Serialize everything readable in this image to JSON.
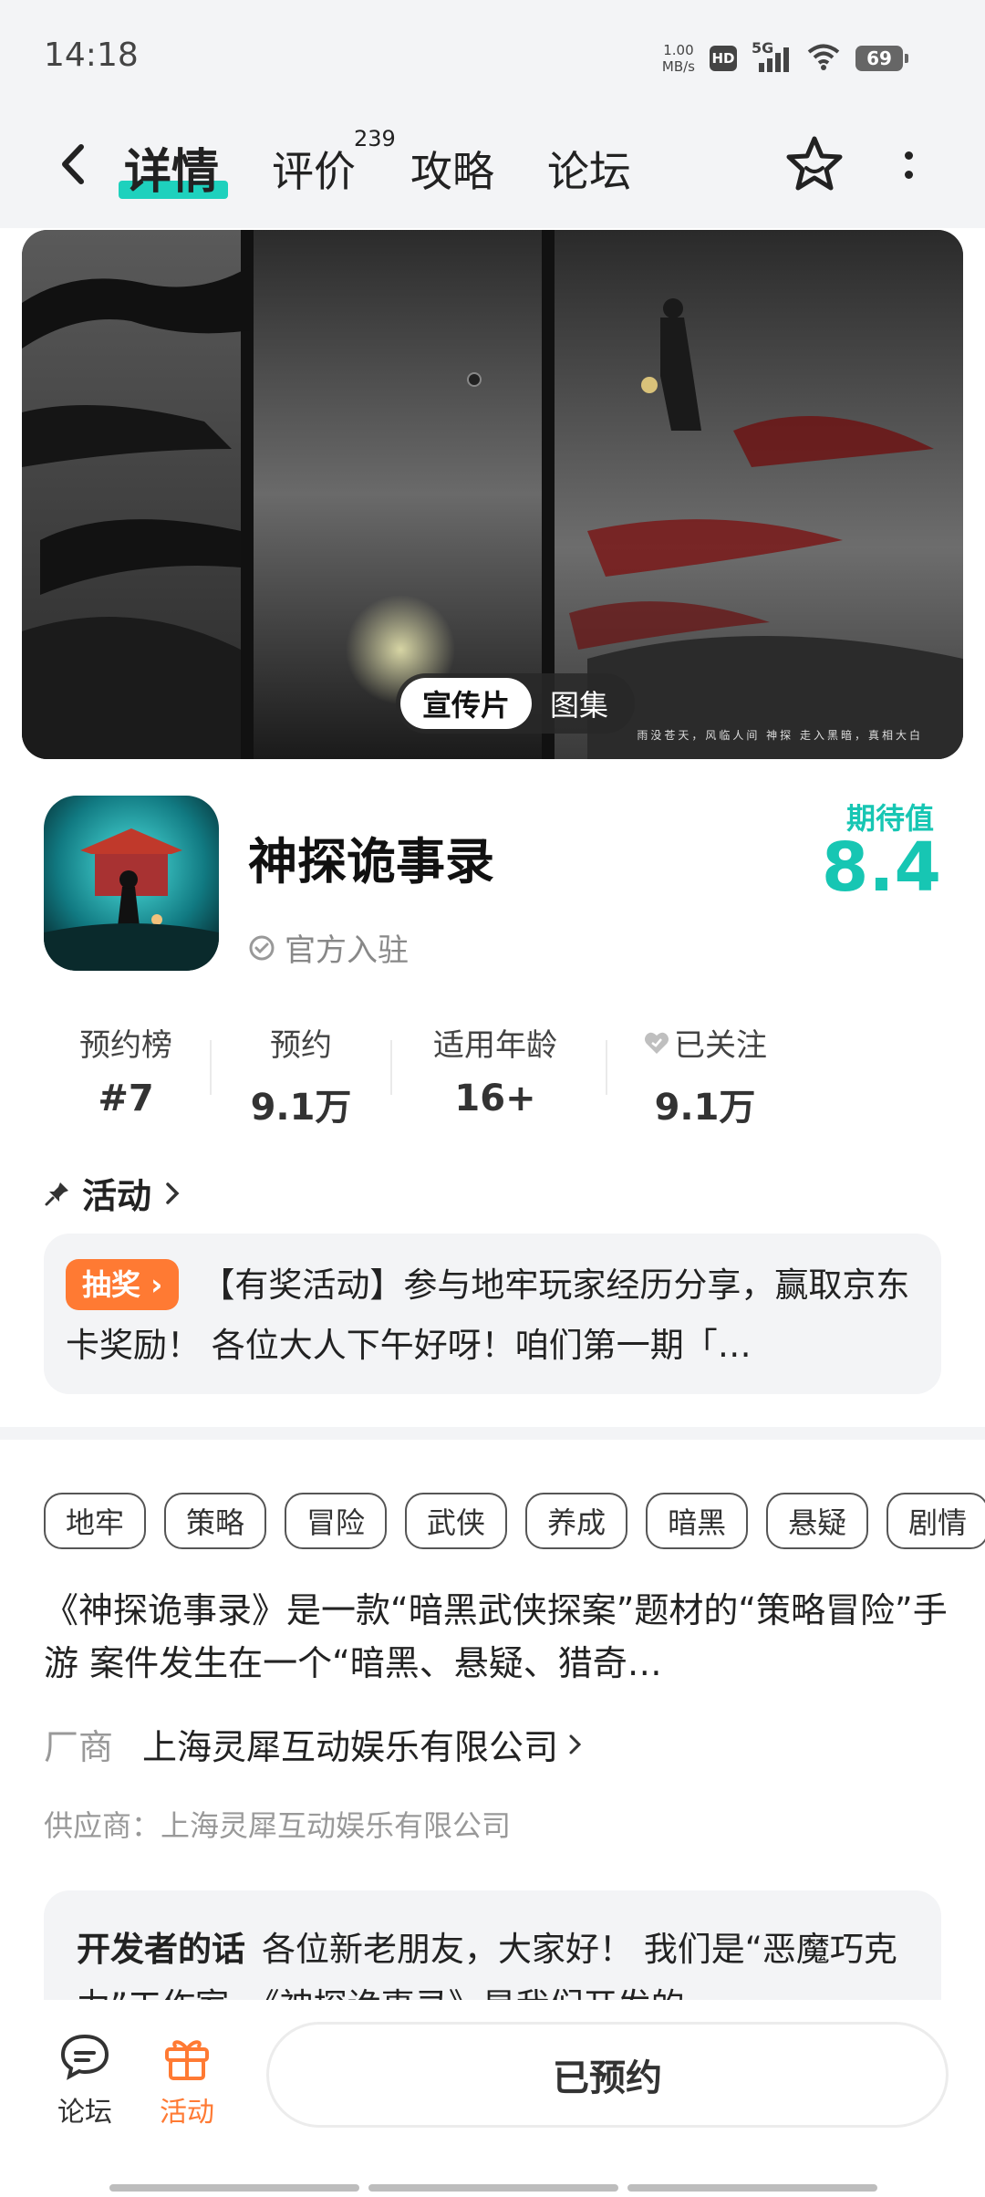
{
  "status_bar": {
    "time": "14:18",
    "net_speed_value": "1.00",
    "net_speed_unit": "MB/s",
    "hd": "HD",
    "network": "5G",
    "battery": "69"
  },
  "nav": {
    "tabs": [
      {
        "label": "详情",
        "active": true
      },
      {
        "label": "评价",
        "badge": "239"
      },
      {
        "label": "攻略"
      },
      {
        "label": "论坛"
      }
    ]
  },
  "banner": {
    "toggle": {
      "active": "宣传片",
      "inactive": "图集"
    },
    "caption": "雨没苍天，风临人间  神探  走入黑暗，真相大白"
  },
  "game": {
    "title": "神探诡事录",
    "official_label": "官方入驻",
    "expect_label": "期待值",
    "expect_value": "8.4"
  },
  "stats": [
    {
      "label": "预约榜",
      "value": "#7"
    },
    {
      "label": "预约",
      "value": "9.1万"
    },
    {
      "label": "适用年龄",
      "value": "16+"
    },
    {
      "label": "已关注",
      "value": "9.1万"
    }
  ],
  "activity": {
    "heading": "活动",
    "badge": "抽奖",
    "text": "【有奖活动】参与地牢玩家经历分享，赢取京东卡奖励！ 各位大人下午好呀！咱们第一期「…"
  },
  "tags": [
    "地牢",
    "策略",
    "冒险",
    "武侠",
    "养成",
    "暗黑",
    "悬疑",
    "剧情"
  ],
  "description": "《神探诡事录》是一款“暗黑武侠探案”题材的“策略冒险”手游 案件发生在一个“暗黑、悬疑、猎奇…",
  "vendor": {
    "label": "厂商",
    "name": "上海灵犀互动娱乐有限公司"
  },
  "supplier": "供应商：上海灵犀互动娱乐有限公司",
  "developer": {
    "label": "开发者的话",
    "text": "各位新老朋友，大家好！ 我们是“恶魔巧克力”工作室，《神探诡事录》是我们开发的"
  },
  "bottom_bar": {
    "forum_label": "论坛",
    "activity_label": "活动",
    "reserve_label": "已预约"
  },
  "colors": {
    "accent": "#1ed1bd",
    "expect": "#17c6b3",
    "orange": "#ff7a33"
  }
}
